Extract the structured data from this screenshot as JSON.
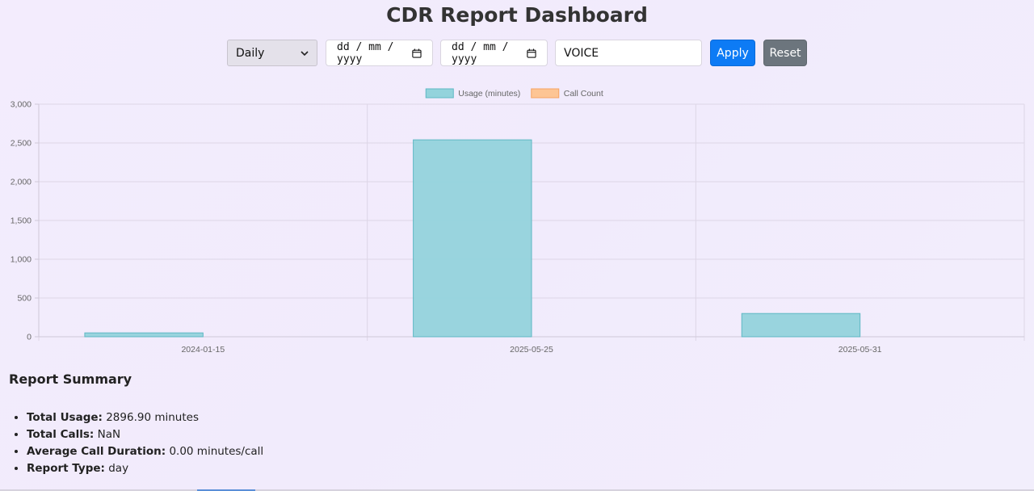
{
  "title": "CDR Report Dashboard",
  "controls": {
    "report_type": "Daily",
    "start_date_placeholder": "dd / mm / yyyy",
    "end_date_placeholder": "dd / mm / yyyy",
    "call_type": "VOICE",
    "apply_label": "Apply",
    "reset_label": "Reset",
    "icons": {
      "dropdown": "chevron-down-icon",
      "calendar": "calendar-icon"
    }
  },
  "chart_data": {
    "type": "bar",
    "categories": [
      "2024-01-15",
      "2025-05-25",
      "2025-05-31"
    ],
    "series": [
      {
        "name": "Usage (minutes)",
        "values": [
          50,
          2540,
          300
        ],
        "color": "#93d3dc"
      },
      {
        "name": "Call Count",
        "values": [
          0,
          0,
          0
        ],
        "color": "#fdc594"
      }
    ],
    "ylim": [
      0,
      3000
    ],
    "yticks": [
      0,
      500,
      1000,
      1500,
      2000,
      2500,
      3000
    ],
    "ytick_labels": [
      "0",
      "500",
      "1,000",
      "1,500",
      "2,000",
      "2,500",
      "3,000"
    ],
    "grid": true,
    "legend": "top-center"
  },
  "summary": {
    "heading": "Report Summary",
    "items": [
      {
        "label": "Total Usage:",
        "value": "2896.90 minutes"
      },
      {
        "label": "Total Calls:",
        "value": "NaN"
      },
      {
        "label": "Average Call Duration:",
        "value": "0.00 minutes/call"
      },
      {
        "label": "Report Type:",
        "value": "day"
      }
    ]
  }
}
